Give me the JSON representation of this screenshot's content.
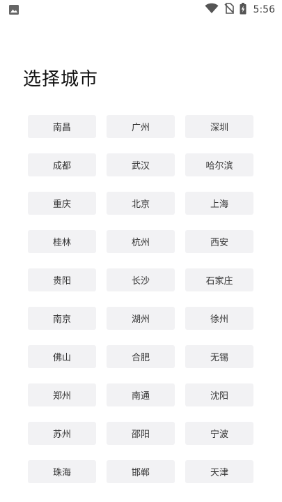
{
  "status_bar": {
    "time": "5:56",
    "icons": [
      "gallery-icon",
      "wifi-icon",
      "no-sim-icon",
      "battery-icon"
    ]
  },
  "page": {
    "title": "选择城市"
  },
  "cities": [
    "南昌",
    "广州",
    "深圳",
    "成都",
    "武汉",
    "哈尔滨",
    "重庆",
    "北京",
    "上海",
    "桂林",
    "杭州",
    "西安",
    "贵阳",
    "长沙",
    "石家庄",
    "南京",
    "湖州",
    "徐州",
    "佛山",
    "合肥",
    "无锡",
    "郑州",
    "南通",
    "沈阳",
    "苏州",
    "邵阳",
    "宁波",
    "珠海",
    "邯郸",
    "天津"
  ],
  "colors": {
    "button_bg": "#f2f2f4",
    "text": "#333333",
    "title": "#111111"
  }
}
